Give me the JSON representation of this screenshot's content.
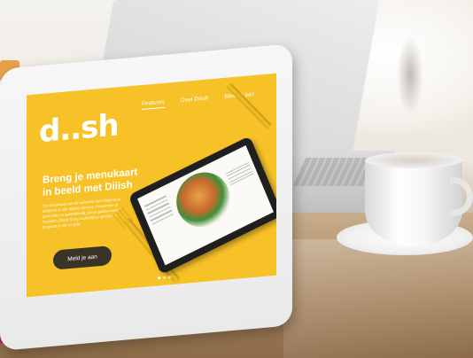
{
  "scene": {
    "description_icons": [
      "laptop",
      "coffee-cup",
      "tablet",
      "cutlery",
      "plant"
    ]
  },
  "site": {
    "logo": "d..sh",
    "nav": [
      {
        "label": "Features",
        "active": true
      },
      {
        "label": "Over Diiish",
        "active": false
      },
      {
        "label": "Meld je aan",
        "active": false
      }
    ],
    "headline": "Breng je menukaart in beeld met Diiish",
    "body": "Op menukaart van de toekomst met Diiish op je tablet en in alle digitale devices. Presenteer je gerechten zo aantrekkelijk, dat je gasten meer bestellen. Diiish is erg makkelijk in gebruik en bespaart je tijd en geld.",
    "cta_label": "Meld je aan",
    "slider_dots": 3,
    "active_dot": 1
  },
  "colors": {
    "brand_yellow": "#f7c128",
    "cta_dark": "#3a3428",
    "text_white": "#ffffff"
  }
}
